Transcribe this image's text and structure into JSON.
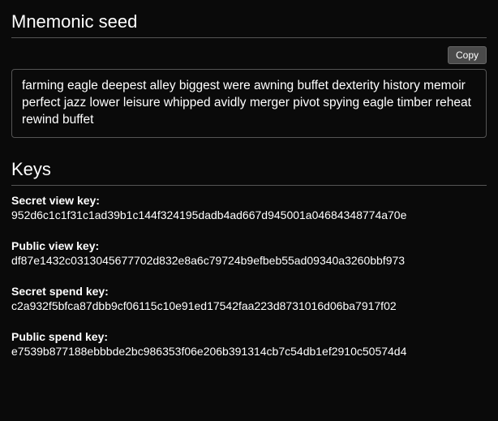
{
  "mnemonic": {
    "title": "Mnemonic seed",
    "copy_label": "Copy",
    "seed": "farming eagle deepest alley biggest were awning buffet dexterity history memoir perfect jazz lower leisure whipped avidly merger pivot spying eagle timber reheat rewind buffet"
  },
  "keys": {
    "title": "Keys",
    "items": [
      {
        "label": "Secret view key:",
        "value": "952d6c1c1f31c1ad39b1c144f324195dadb4ad667d945001a04684348774a70e"
      },
      {
        "label": "Public view key:",
        "value": "df87e1432c0313045677702d832e8a6c79724b9efbeb55ad09340a3260bbf973"
      },
      {
        "label": "Secret spend key:",
        "value": "c2a932f5bfca87dbb9cf06115c10e91ed17542faa223d8731016d06ba7917f02"
      },
      {
        "label": "Public spend key:",
        "value": "e7539b877188ebbbde2bc986353f06e206b391314cb7c54db1ef2910c50574d4"
      }
    ]
  }
}
